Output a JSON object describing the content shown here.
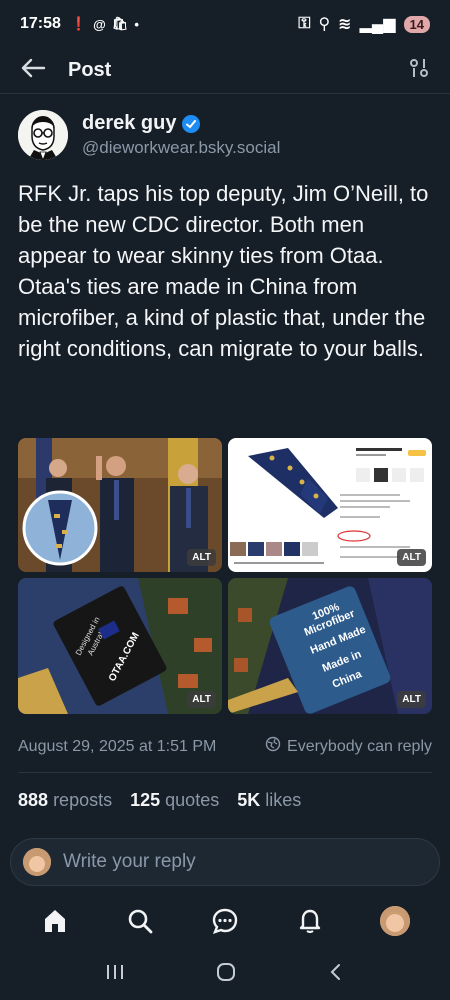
{
  "status_bar": {
    "time": "17:58",
    "battery": "14"
  },
  "header": {
    "title": "Post"
  },
  "author": {
    "name": "derek guy",
    "handle": "@dieworkwear.bsky.social"
  },
  "post": {
    "text": "RFK Jr. taps his top deputy, Jim O’Neill, to be the new CDC director. Both men appear to wear skinny ties from Otaa. Otaa's ties are made in China from microfiber, a kind of plastic that, under the right conditions, can migrate to your balls.",
    "images": [
      {
        "alt_label": "ALT"
      },
      {
        "alt_label": "ALT",
        "caption": "“The ties are amazing! They tied perfectly and look great with my suits!”"
      },
      {
        "alt_label": "ALT",
        "label_lines": [
          "Designed in",
          "Australia",
          "OTAA.COM"
        ]
      },
      {
        "alt_label": "ALT",
        "label_lines": [
          "100%",
          "Microfiber",
          "Hand Made",
          "Made in",
          "China"
        ]
      }
    ],
    "timestamp": "August 29, 2025 at 1:51 PM",
    "reply_setting": "Everybody can reply"
  },
  "counts": {
    "reposts_value": "888",
    "reposts_label": "reposts",
    "quotes_value": "125",
    "quotes_label": "quotes",
    "likes_value": "5K",
    "likes_label": "likes"
  },
  "reply": {
    "placeholder": "Write your reply"
  },
  "colors": {
    "background": "#161e27",
    "accent": "#1d8cf5",
    "muted": "#8a98a8"
  }
}
